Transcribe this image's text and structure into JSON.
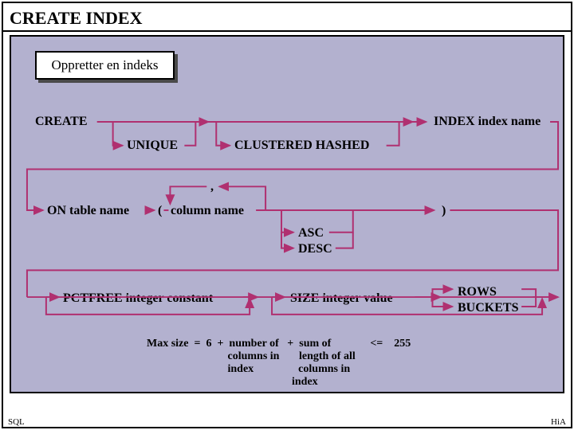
{
  "title": "CREATE INDEX",
  "subtitle": "Oppretter en indeks",
  "nodes": {
    "create": "CREATE",
    "unique": "UNIQUE",
    "clustered": "CLUSTERED HASHED",
    "index_name": "INDEX index name",
    "on_table": "ON table name",
    "lparen": "(",
    "comma": ",",
    "colname": "column name",
    "rparen": ")",
    "asc": "ASC",
    "desc": "DESC",
    "pctfree": "PCTFREE integer constant",
    "size": "SIZE integer value",
    "rows": "ROWS",
    "buckets": "BUCKETS"
  },
  "formula_l1": "Max size  =  6  +  number of   +  sum of              <=    255",
  "formula_l2": "                             columns in       length of all",
  "formula_l3": "                             index                columns in",
  "formula_l4": "                                                    index",
  "footer_left": "SQL",
  "footer_right": "HiA",
  "colors": {
    "arrow": "#b03070"
  }
}
